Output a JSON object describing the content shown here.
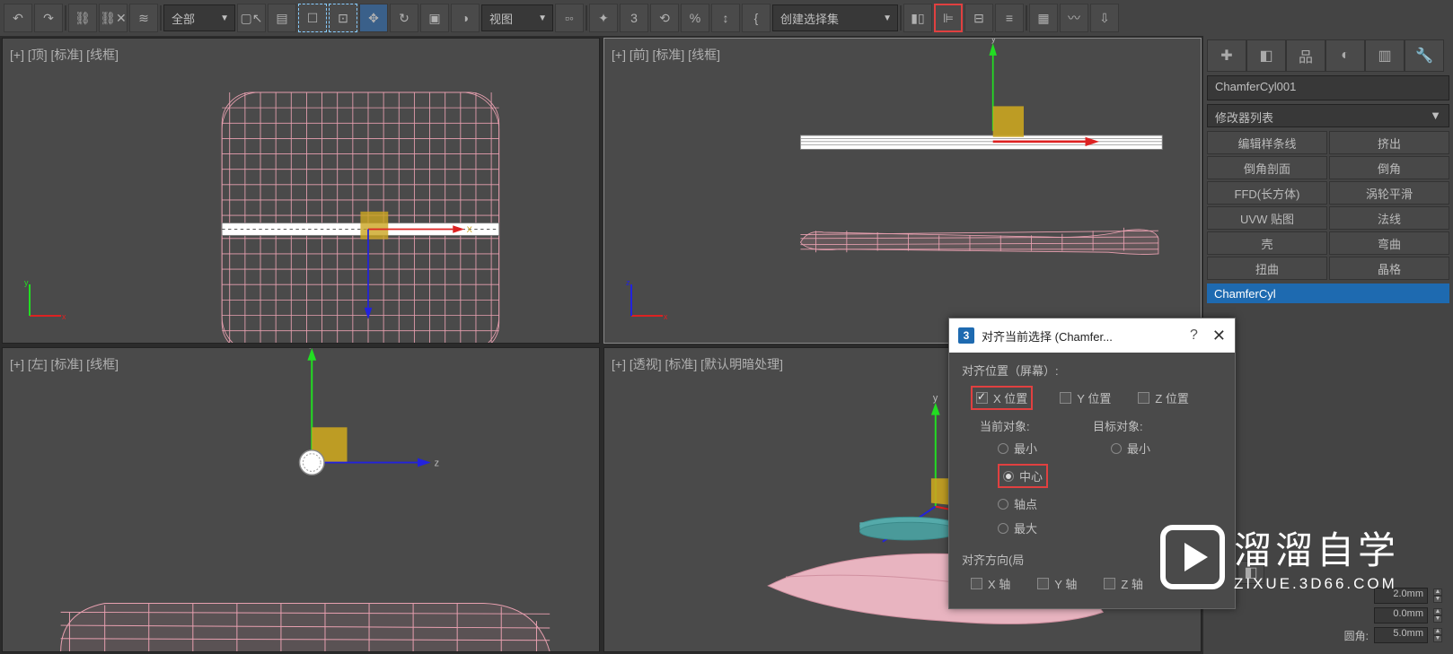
{
  "toolbar": {
    "sel_all": "全部",
    "sel_view": "视图",
    "sel_set": "创建选择集",
    "percent_char": "%",
    "angle_char": "3",
    "curly": "{"
  },
  "viewports": {
    "top_label": "[+] [顶] [标准] [线框]",
    "front_label": "[+] [前] [标准] [线框]",
    "left_label": "[+] [左] [标准] [线框]",
    "persp_label": "[+] [透视] [标准] [默认明暗处理]"
  },
  "panel": {
    "object_name": "ChamferCyl001",
    "modifier_list": "修改器列表",
    "btns": [
      [
        "编辑样条线",
        "挤出"
      ],
      [
        "倒角剖面",
        "倒角"
      ],
      [
        "FFD(长方体)",
        "涡轮平滑"
      ],
      [
        "UVW 贴图",
        "法线"
      ],
      [
        "壳",
        "弯曲"
      ],
      [
        "扭曲",
        "晶格"
      ]
    ],
    "stack_item": "ChamferCyl",
    "spinner_a_val": "2.0mm",
    "spinner_b_val": "0.0mm",
    "spinner_c_label": "圆角:",
    "spinner_c_val": "5.0mm"
  },
  "dialog": {
    "title": "对齐当前选择 (Chamfer...",
    "icon_char": "3",
    "help": "?",
    "close": "✕",
    "align_pos": "对齐位置（屏幕）:",
    "x_pos": "X 位置",
    "y_pos": "Y 位置",
    "z_pos": "Z 位置",
    "current_obj": "当前对象:",
    "target_obj": "目标对象:",
    "min": "最小",
    "center": "中心",
    "pivot": "轴点",
    "max": "最大",
    "align_orient": "对齐方向(局",
    "x_axis": "X 轴",
    "y_axis": "Y 轴",
    "z_axis": "Z 轴"
  },
  "watermark": {
    "cn": "溜溜自学",
    "en": "ZIXUE.3D66.COM"
  }
}
